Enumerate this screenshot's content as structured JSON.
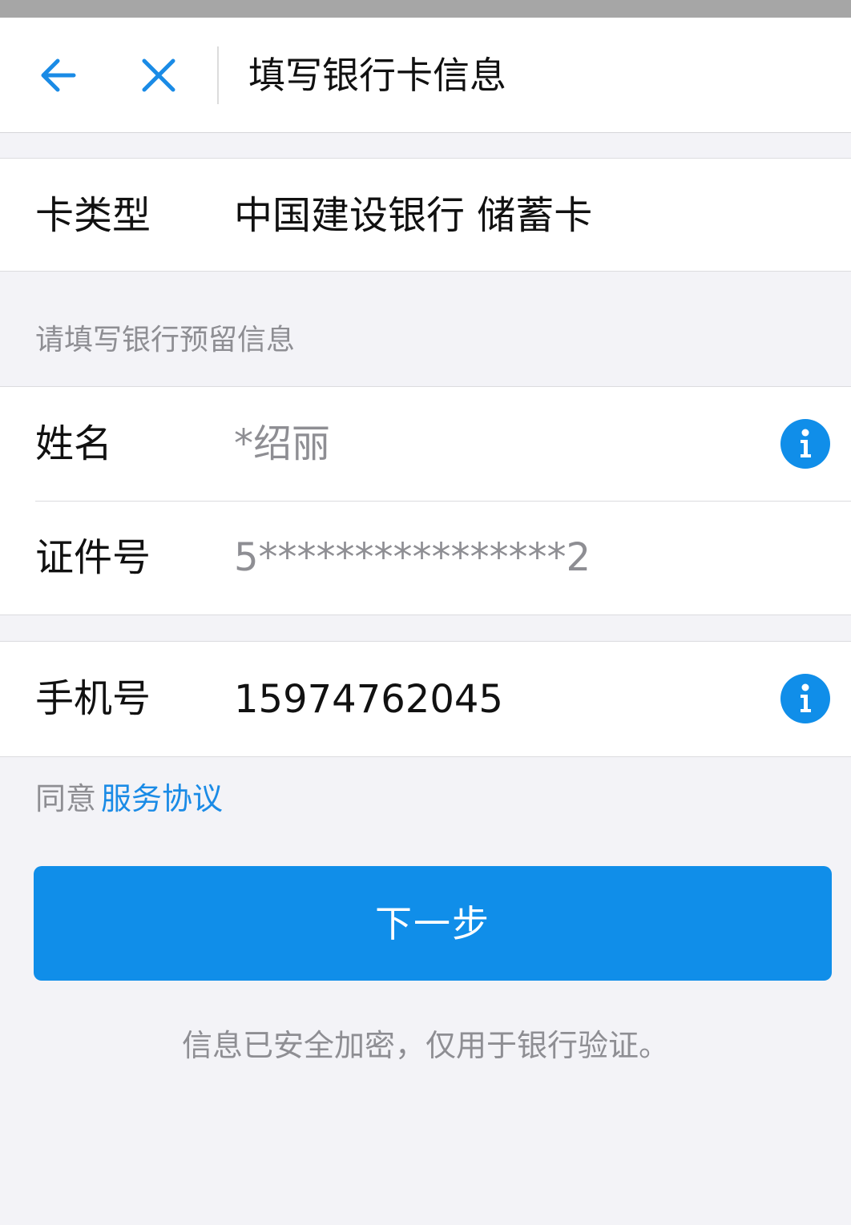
{
  "header": {
    "title": "填写银行卡信息",
    "back_icon": "back-arrow-icon",
    "close_icon": "close-icon",
    "accent_color": "#1a8be6"
  },
  "card_type": {
    "label": "卡类型",
    "value": "中国建设银行 储蓄卡"
  },
  "reserved_info": {
    "section_hint": "请填写银行预留信息",
    "name": {
      "label": "姓名",
      "value": "*绍丽",
      "info_icon": "info-icon"
    },
    "id_number": {
      "label": "证件号",
      "value": "5****************2"
    }
  },
  "phone": {
    "label": "手机号",
    "value": "15974762045",
    "info_icon": "info-icon"
  },
  "agreement": {
    "prefix": "同意",
    "link_text": "服务协议"
  },
  "next_button": {
    "label": "下一步",
    "color": "#108ee9"
  },
  "footer_note": "信息已安全加密，仅用于银行验证。"
}
